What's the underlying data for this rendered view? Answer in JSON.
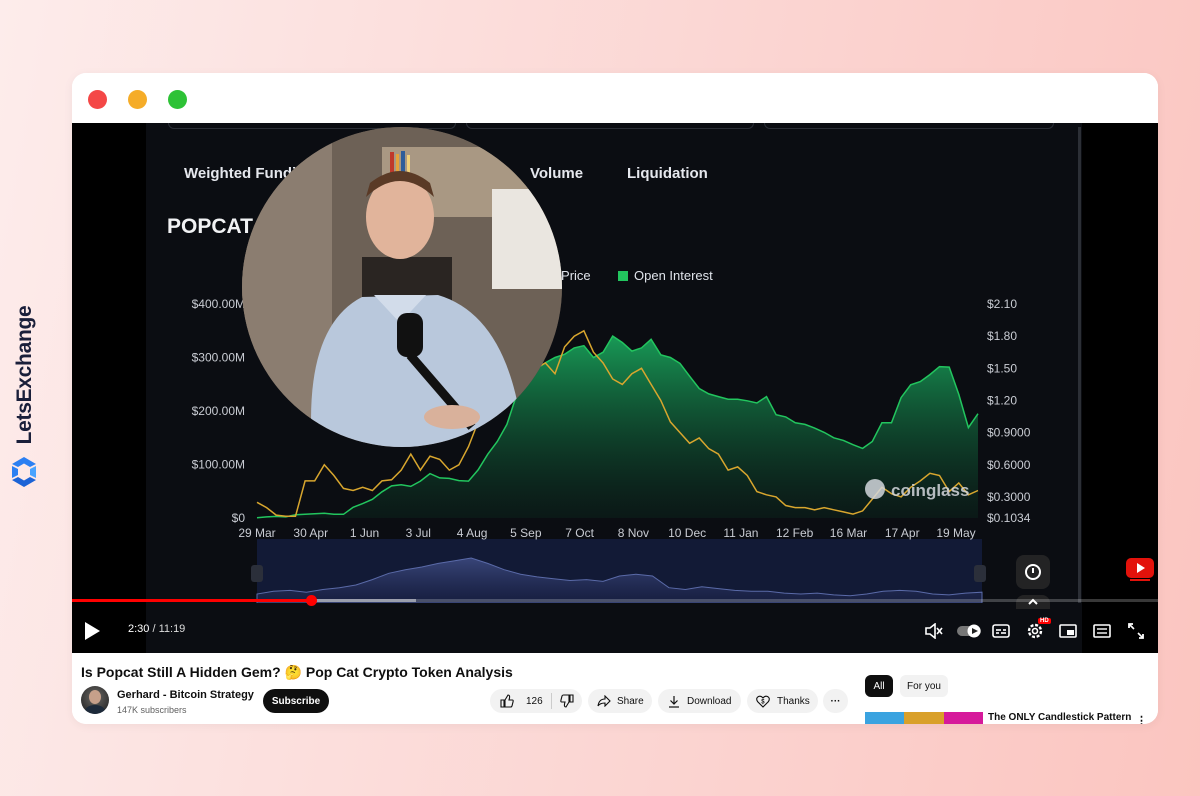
{
  "brand": {
    "name": "LetsExchange"
  },
  "player": {
    "tabs": [
      "Weighted Fundi",
      "Volume",
      "Liquidation"
    ],
    "chart_title": "POPCAT",
    "legend": {
      "price_label": "AT Price",
      "oi_label": "Open Interest"
    },
    "watermark": "coinglass",
    "time_current": "2:30",
    "time_separator": " / ",
    "time_duration": "11:19",
    "progress": 0.22,
    "buffered": 0.317,
    "hd_badge": "HD"
  },
  "chart_data": {
    "type": "area",
    "title": "POPCAT",
    "series": [
      {
        "name": "Open Interest",
        "axis": "left",
        "color": "#22c55e",
        "values": [
          0.5,
          2,
          3,
          2,
          6,
          7,
          8,
          9,
          7,
          7,
          20,
          27,
          35,
          49,
          60,
          62,
          59,
          69,
          83,
          75,
          74,
          70,
          69,
          90,
          119,
          143,
          175,
          230,
          256,
          278,
          290,
          300,
          306,
          318,
          322,
          300,
          310,
          340,
          328,
          312,
          318,
          334,
          305,
          300,
          289,
          265,
          242,
          232,
          227,
          222,
          222,
          219,
          215,
          227,
          193,
          189,
          178,
          175,
          168,
          160,
          150,
          145,
          137,
          130,
          143,
          178,
          178,
          225,
          249,
          255,
          268,
          283,
          282,
          231,
          169,
          195
        ]
      },
      {
        "name": "AT Price",
        "axis": "right",
        "color": "#d8a62e",
        "values": [
          0.25,
          0.2,
          0.13,
          0.12,
          0.12,
          0.45,
          0.45,
          0.6,
          0.5,
          0.38,
          0.36,
          0.39,
          0.36,
          0.45,
          0.46,
          0.55,
          0.7,
          0.55,
          0.68,
          0.65,
          0.55,
          0.6,
          0.77,
          1.0,
          1.18,
          1.35,
          1.45,
          1.42,
          1.4,
          1.5,
          1.55,
          1.45,
          1.7,
          1.8,
          1.85,
          1.65,
          1.55,
          1.4,
          1.35,
          1.45,
          1.5,
          1.35,
          1.2,
          1.0,
          0.9,
          0.8,
          0.85,
          0.75,
          0.7,
          0.55,
          0.58,
          0.5,
          0.35,
          0.32,
          0.3,
          0.22,
          0.2,
          0.2,
          0.18,
          0.2,
          0.18,
          0.16,
          0.14,
          0.17,
          0.28,
          0.39,
          0.33,
          0.3,
          0.39,
          0.45,
          0.52,
          0.5,
          0.35,
          0.43,
          0.32,
          0.36
        ]
      }
    ],
    "x_labels": [
      "29 Mar",
      "30 Apr",
      "1 Jun",
      "3 Jul",
      "4 Aug",
      "5 Sep",
      "7 Oct",
      "8 Nov",
      "10 Dec",
      "11 Jan",
      "12 Feb",
      "16 Mar",
      "17 Apr",
      "19 May"
    ],
    "y_left_labels": [
      "$400.00M",
      "$300.00M",
      "$200.00M",
      "$100.00M",
      "$0"
    ],
    "y_left_range": [
      0,
      400
    ],
    "y_left_unit": "$M",
    "y_right_labels": [
      "$2.10",
      "$1.80",
      "$1.50",
      "$1.20",
      "$0.9000",
      "$0.6000",
      "$0.3000",
      "$0.1034"
    ],
    "y_right_range": [
      0.1034,
      2.1
    ],
    "navigator": [
      10,
      13,
      14,
      12,
      15,
      17,
      20,
      26,
      33,
      37,
      40,
      44,
      47,
      50,
      44,
      37,
      32,
      29,
      27,
      25,
      26,
      24,
      30,
      32,
      30,
      17,
      15,
      18,
      16,
      14,
      13,
      13,
      11,
      10,
      11,
      9,
      8,
      10,
      13,
      14,
      13,
      10,
      9,
      11,
      12
    ]
  },
  "video": {
    "title": "Is Popcat Still A Hidden Gem? 🤔 Pop Cat Crypto Token Analysis",
    "channel": "Gerhard - Bitcoin Strategy",
    "subscribers": "147K subscribers",
    "subscribe_label": "Subscribe",
    "likes": "126",
    "share_label": "Share",
    "download_label": "Download",
    "thanks_label": "Thanks",
    "more_label": "···"
  },
  "sidebar": {
    "chips": [
      "All",
      "For you"
    ],
    "recommended_title": "The ONLY Candlestick Pattern"
  },
  "colors": {
    "accent_red": "#ff0000",
    "oi_green": "#22c55e",
    "price_gold": "#d8a62e"
  }
}
